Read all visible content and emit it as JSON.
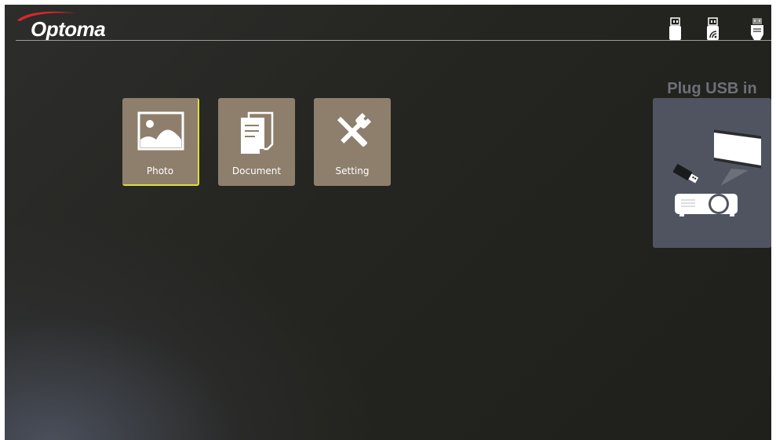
{
  "brand": {
    "name": "Optoma",
    "accent_color": "#d9262c"
  },
  "status_icons": [
    {
      "name": "usb-drive-icon"
    },
    {
      "name": "wireless-usb-icon"
    },
    {
      "name": "usb-connector-icon"
    }
  ],
  "menu": {
    "items": [
      {
        "label": "Photo",
        "icon": "photo-icon",
        "selected": true
      },
      {
        "label": "Document",
        "icon": "document-icon",
        "selected": false
      },
      {
        "label": "Setting",
        "icon": "settings-tools-icon",
        "selected": false
      }
    ],
    "tile_color": "#8e7f6d",
    "focus_color": "#d8e23a"
  },
  "plug_prompt": {
    "title": "Plug USB in",
    "panel_color": "#4f5460"
  }
}
